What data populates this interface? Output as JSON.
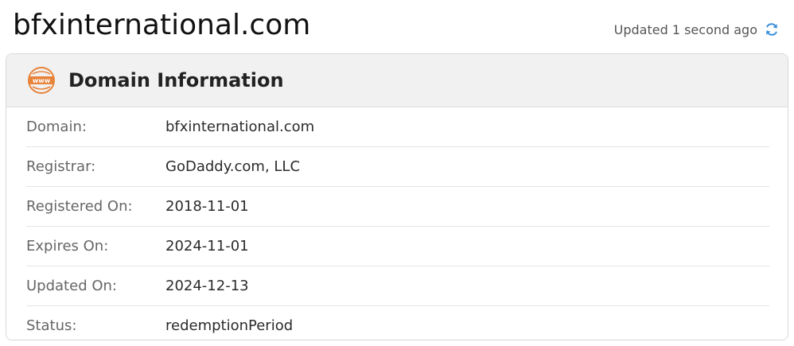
{
  "page": {
    "domain": "bfxinternational.com",
    "updated_text": "Updated 1 second ago"
  },
  "card": {
    "title": "Domain Information",
    "icon": "www-icon",
    "rows": [
      {
        "label": "Domain:",
        "value": "bfxinternational.com"
      },
      {
        "label": "Registrar:",
        "value": "GoDaddy.com, LLC"
      },
      {
        "label": "Registered On:",
        "value": "2018-11-01"
      },
      {
        "label": "Expires On:",
        "value": "2024-11-01"
      },
      {
        "label": "Updated On:",
        "value": "2024-12-13"
      },
      {
        "label": "Status:",
        "value": "redemptionPeriod"
      }
    ]
  },
  "colors": {
    "accent_icon": "#e8833a",
    "refresh_icon": "#3b8fd9",
    "header_bg": "#f1f1f1"
  }
}
